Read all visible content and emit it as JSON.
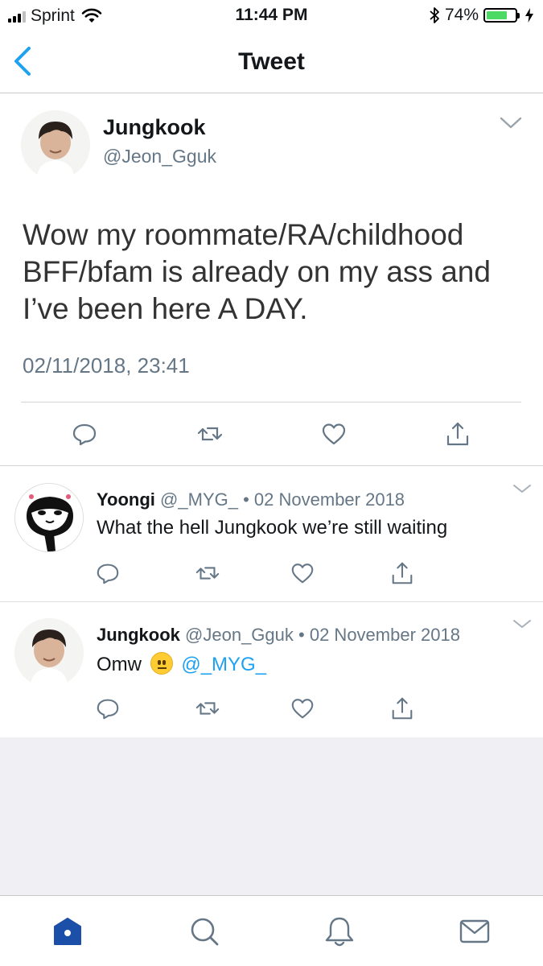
{
  "status_bar": {
    "carrier": "Sprint",
    "time": "11:44 PM",
    "battery_percent": "74%",
    "battery_level": 0.74
  },
  "nav": {
    "title": "Tweet"
  },
  "main_tweet": {
    "name": "Jungkook",
    "handle": "@Jeon_Gguk",
    "text_lines": [
      "Wow my roommate/RA/childhood",
      "BFF/bfam is already on my ass and",
      "I’ve been here A DAY."
    ],
    "timestamp": "02/11/2018, 23:41"
  },
  "replies": [
    {
      "name": "Yoongi",
      "handle": "@_MYG_",
      "separator": "•",
      "date": "02 November 2018",
      "text": "What the hell Jungkook we’re still waiting"
    },
    {
      "name": "Jungkook",
      "handle": "@Jeon_Gguk",
      "separator": "•",
      "date": "02 November 2018",
      "text": "Omw",
      "emoji": "neutral-face",
      "mention": "@_MYG_"
    }
  ],
  "icons": {
    "accent": "#1da1f2",
    "tab_active": "#1b4fa8",
    "icon_gray": "#657786"
  }
}
